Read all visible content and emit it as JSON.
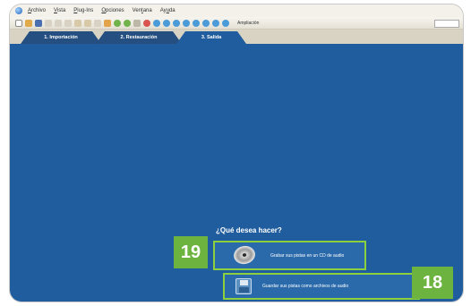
{
  "menubar": {
    "items": [
      {
        "pre": "",
        "u": "A",
        "rest": "rchivo"
      },
      {
        "pre": "",
        "u": "V",
        "rest": "ista"
      },
      {
        "pre": "",
        "u": "P",
        "rest": "lug-Ins"
      },
      {
        "pre": "",
        "u": "O",
        "rest": "pciones"
      },
      {
        "pre": "Ven",
        "u": "t",
        "rest": "ana"
      },
      {
        "pre": "Ay",
        "u": "u",
        "rest": "da"
      }
    ]
  },
  "toolbar": {
    "zoom_label": "Ampliación"
  },
  "tabs": [
    {
      "label": "1. Importación"
    },
    {
      "label": "2. Restauración"
    },
    {
      "label": "3. Salida"
    }
  ],
  "main": {
    "question": "¿Qué desea hacer?",
    "options": [
      {
        "label": "Grabar sus pistas en un CD de audio",
        "icon": "cd-icon"
      },
      {
        "label": "Guardar sus pistas como archivos de audio",
        "icon": "floppy-icon"
      }
    ]
  },
  "annotations": {
    "badge_19": "19",
    "badge_18": "18",
    "highlight_color": "#8ccf3f",
    "badge_color": "#6db33f"
  },
  "colors": {
    "content_bg": "#1f5d9e",
    "tab_bg": "#244f80"
  }
}
